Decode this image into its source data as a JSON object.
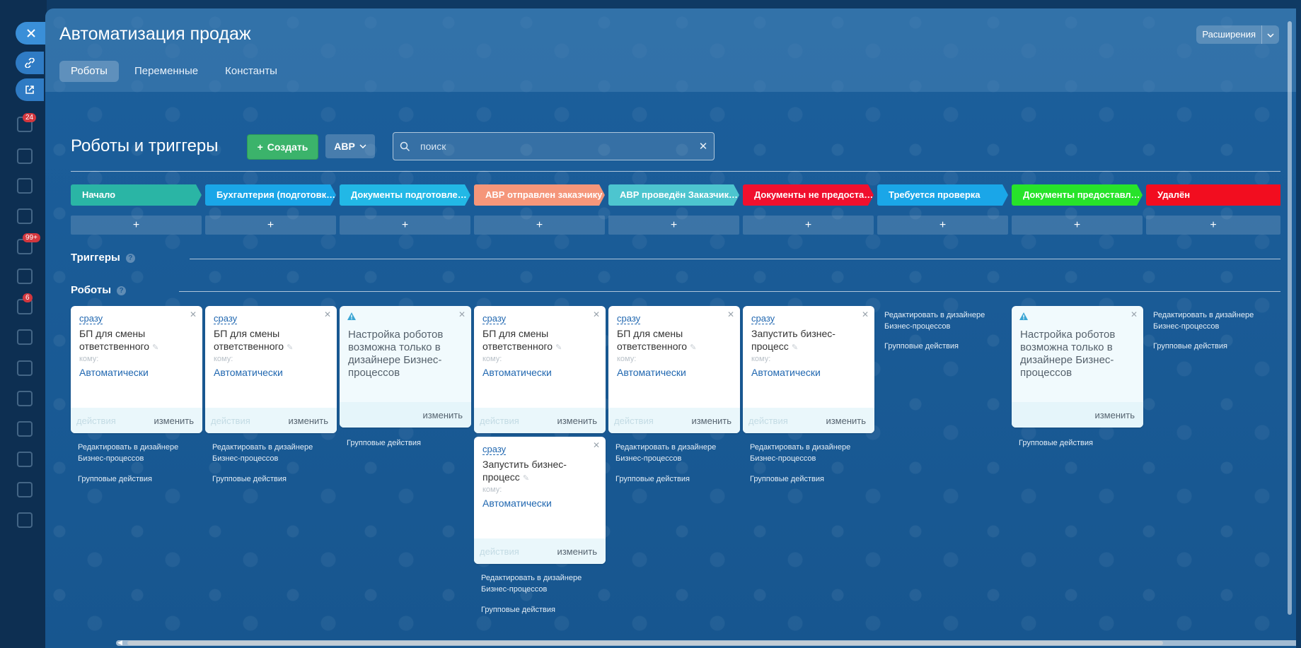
{
  "panel": {
    "title": "Автоматизация продаж",
    "tabs": [
      {
        "label": "Роботы",
        "active": true
      },
      {
        "label": "Переменные",
        "active": false
      },
      {
        "label": "Константы",
        "active": false
      }
    ],
    "extensions_label": "Расширения"
  },
  "toolbar": {
    "heading": "Роботы и триггеры",
    "create_label": "Создать",
    "filter_label": "АВР",
    "search_placeholder": "поиск"
  },
  "stages": [
    {
      "label": "Начало",
      "color": "#2ab5a5"
    },
    {
      "label": "Бухгалтерия (подготовка документов)",
      "color": "#1aa6e8"
    },
    {
      "label": "Документы подготовлены",
      "color": "#22b8e6"
    },
    {
      "label": "АВР отправлен заказчику",
      "color": "#f5967a"
    },
    {
      "label": "АВР проведён Заказчиком",
      "color": "#4dc5cf"
    },
    {
      "label": "Документы не предоставлены",
      "color": "#f0102e"
    },
    {
      "label": "Требуется проверка",
      "color": "#1aa6e8"
    },
    {
      "label": "Документы предоставлены",
      "color": "#27e32a"
    },
    {
      "label": "Удалён",
      "color": "#f20d1f"
    }
  ],
  "sections": {
    "triggers_label": "Триггеры",
    "robots_label": "Роботы"
  },
  "card_text": {
    "when": "сразу",
    "bp_change": "БП для смены ответственного",
    "run_bp": "Запустить бизнес-процесс",
    "to": "кому:",
    "auto": "Автоматически",
    "actions": "действия",
    "edit": "изменить",
    "warning": "Настройка роботов возможна только в дизайнере Бизнес-процессов"
  },
  "links": {
    "designer": "Редактировать в дизайнере Бизнес-процессов",
    "group": "Групповые действия"
  },
  "background": {
    "badges": [
      "24",
      "99+",
      "6"
    ]
  }
}
